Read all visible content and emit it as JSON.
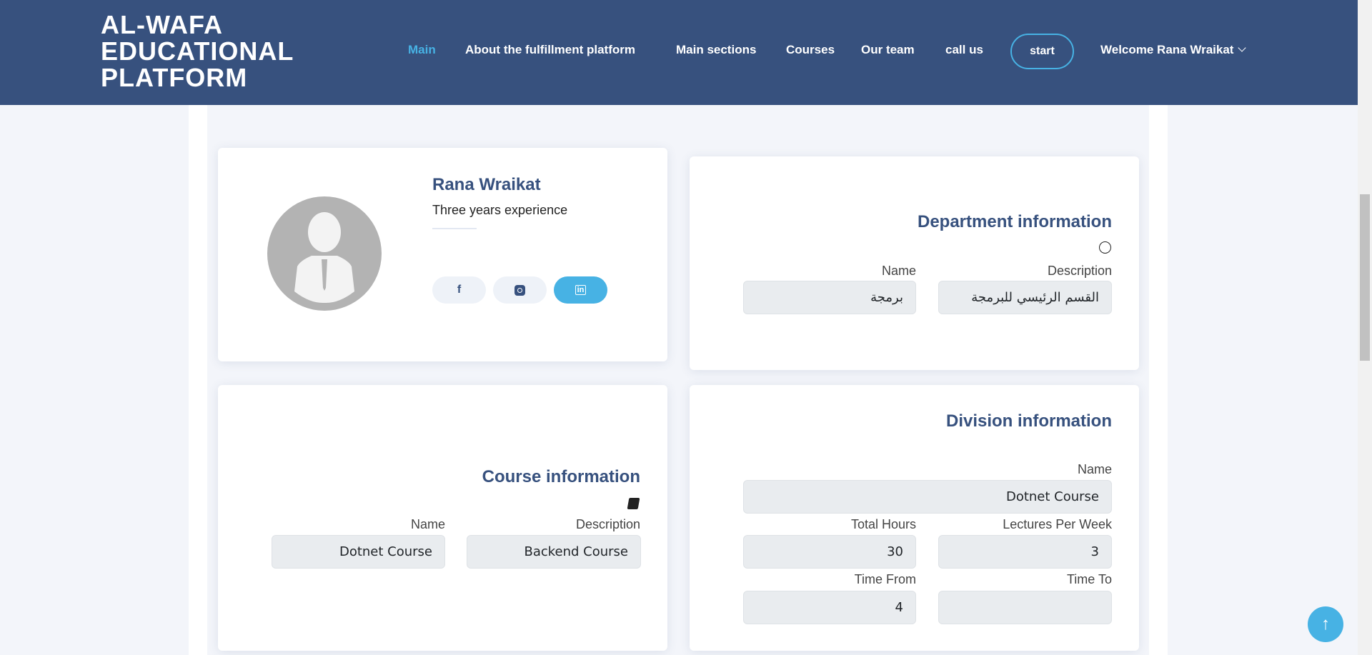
{
  "header": {
    "logo": "AL-WAFA EDUCATIONAL PLATFORM",
    "nav": [
      "Main",
      "About the fulfillment platform",
      "Main sections",
      "Courses",
      "Our team",
      "call us"
    ],
    "start": "start",
    "welcome": "Welcome Rana Wraikat"
  },
  "profile": {
    "name": "Rana Wraikat",
    "subtitle": "Three years experience",
    "social": [
      "facebook-icon",
      "instagram-icon",
      "linkedin-icon"
    ]
  },
  "department": {
    "title": "Department information",
    "icon": "dribbble-icon",
    "name_label": "Name",
    "name_value": "برمجة",
    "desc_label": "Description",
    "desc_value": "القسم الرئيسي للبرمجة"
  },
  "course": {
    "title": "Course information",
    "icon": "book-icon",
    "name_label": "Name",
    "name_value": "Dotnet Course",
    "desc_label": "Description",
    "desc_value": "Backend Course"
  },
  "division": {
    "title": "Division information",
    "name_label": "Name",
    "name_value": "Dotnet Course",
    "hours_label": "Total Hours",
    "hours_value": "30",
    "lectures_label": "Lectures Per Week",
    "lectures_value": "3",
    "from_label": "Time From",
    "from_value": "4",
    "to_label": "Time To",
    "to_value": ""
  },
  "colors": {
    "primary": "#37517e",
    "accent": "#47b2e4"
  }
}
